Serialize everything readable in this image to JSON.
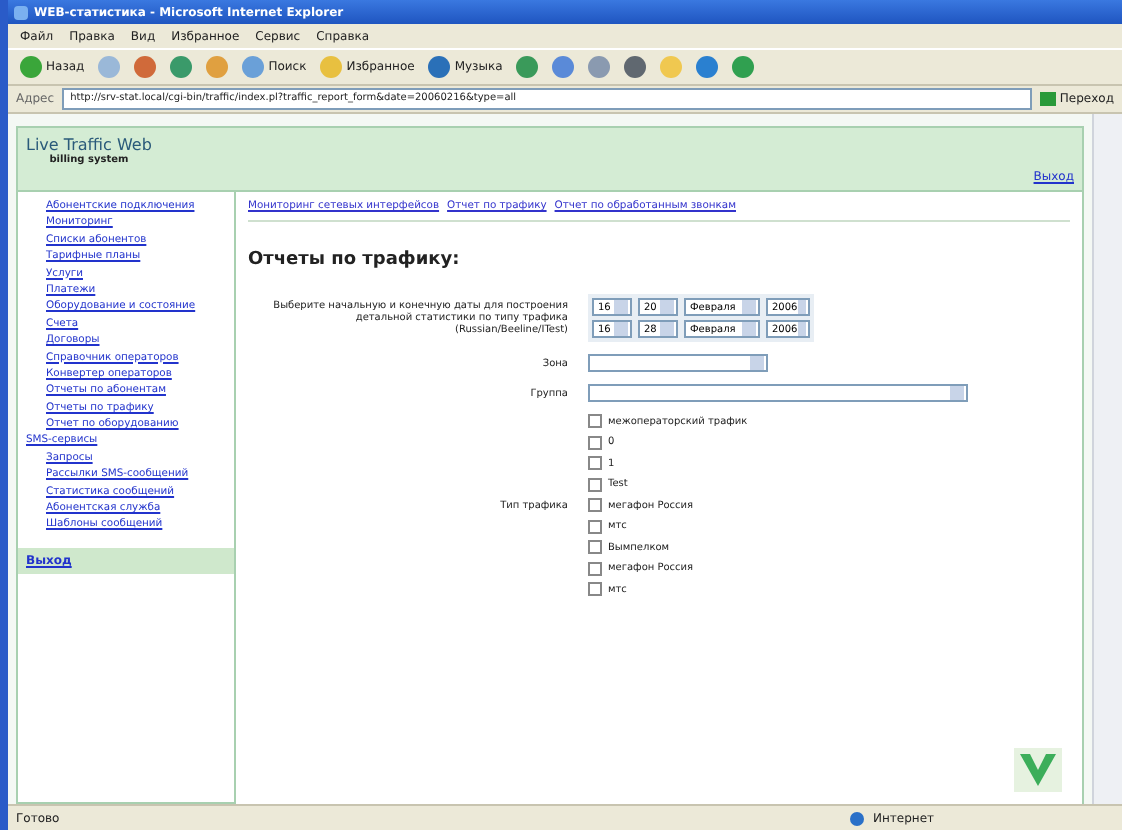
{
  "window": {
    "title": "WEB-статистика - Microsoft Internet Explorer"
  },
  "menu": [
    "Файл",
    "Правка",
    "Вид",
    "Избранное",
    "Сервис",
    "Справка"
  ],
  "toolbar": [
    {
      "kind": "back",
      "label": "Назад"
    },
    {
      "kind": "forward"
    },
    {
      "kind": "stop"
    },
    {
      "kind": "refresh"
    },
    {
      "kind": "home"
    },
    {
      "kind": "search",
      "label": "Поиск"
    },
    {
      "kind": "favorites",
      "label": "Избранное"
    },
    {
      "kind": "media",
      "label": "Музыка"
    },
    {
      "kind": "history"
    },
    {
      "kind": "mail"
    },
    {
      "kind": "print"
    },
    {
      "kind": "edit"
    },
    {
      "kind": "folder"
    },
    {
      "kind": "messenger"
    },
    {
      "kind": "globe"
    }
  ],
  "address": {
    "label": "Адрес",
    "value": "http://srv-stat.local/cgi-bin/traffic/index.pl?traffic_report_form&date=20060216&type=all",
    "go": "Переход"
  },
  "site": {
    "title": "Live Traffic Web",
    "subtitle": "billing system",
    "logout": "Выход"
  },
  "sidebar": {
    "items": [
      "Абонентские подключения",
      "Мониторинг",
      "Списки абонентов",
      "Тарифные планы",
      "Услуги",
      "Платежи",
      "Оборудование и состояние",
      "Счета",
      "Договоры",
      "Справочник операторов",
      "Конвертер операторов",
      "Отчеты по абонентам",
      "Отчеты по трафику",
      "Отчет по оборудованию"
    ],
    "section": "SMS-сервисы",
    "section_items": [
      "Запросы",
      "Рассылки SMS-сообщений",
      "Статистика сообщений",
      "Абонентская служба",
      "Шаблоны сообщений"
    ],
    "footer": "Выход"
  },
  "breadcrumbs": [
    "Мониторинг сетевых интерфейсов",
    "Отчет по трафику",
    "Отчет по обработанным звонкам"
  ],
  "heading": "Отчеты по трафику:",
  "form": {
    "period_label": "Выберите начальную и конечную даты для построения детальной статистики по типу трафика (Russian/Beeline/ITest)",
    "dates": [
      [
        "16",
        "20",
        "Февраля",
        "2006"
      ],
      [
        "16",
        "28",
        "Февраля",
        "2006"
      ]
    ],
    "zone_label": "Зона",
    "group_label": "Группа",
    "traffic_label": "Тип трафика",
    "traffic_types": [
      {
        "label": "межоператорский трафик",
        "checked": false
      },
      {
        "label": "0",
        "checked": false
      },
      {
        "label": "1",
        "checked": false
      },
      {
        "label": "Test",
        "checked": false
      },
      {
        "label": "мегафон Россия",
        "checked": false
      },
      {
        "label": "мтс",
        "checked": false
      },
      {
        "label": "Вымпелком",
        "checked": false
      },
      {
        "label": "мегафон Россия",
        "checked": false
      },
      {
        "label": "мтс",
        "checked": false
      }
    ]
  },
  "status_bar": {
    "text": "Готово",
    "zone": "Интернет"
  }
}
